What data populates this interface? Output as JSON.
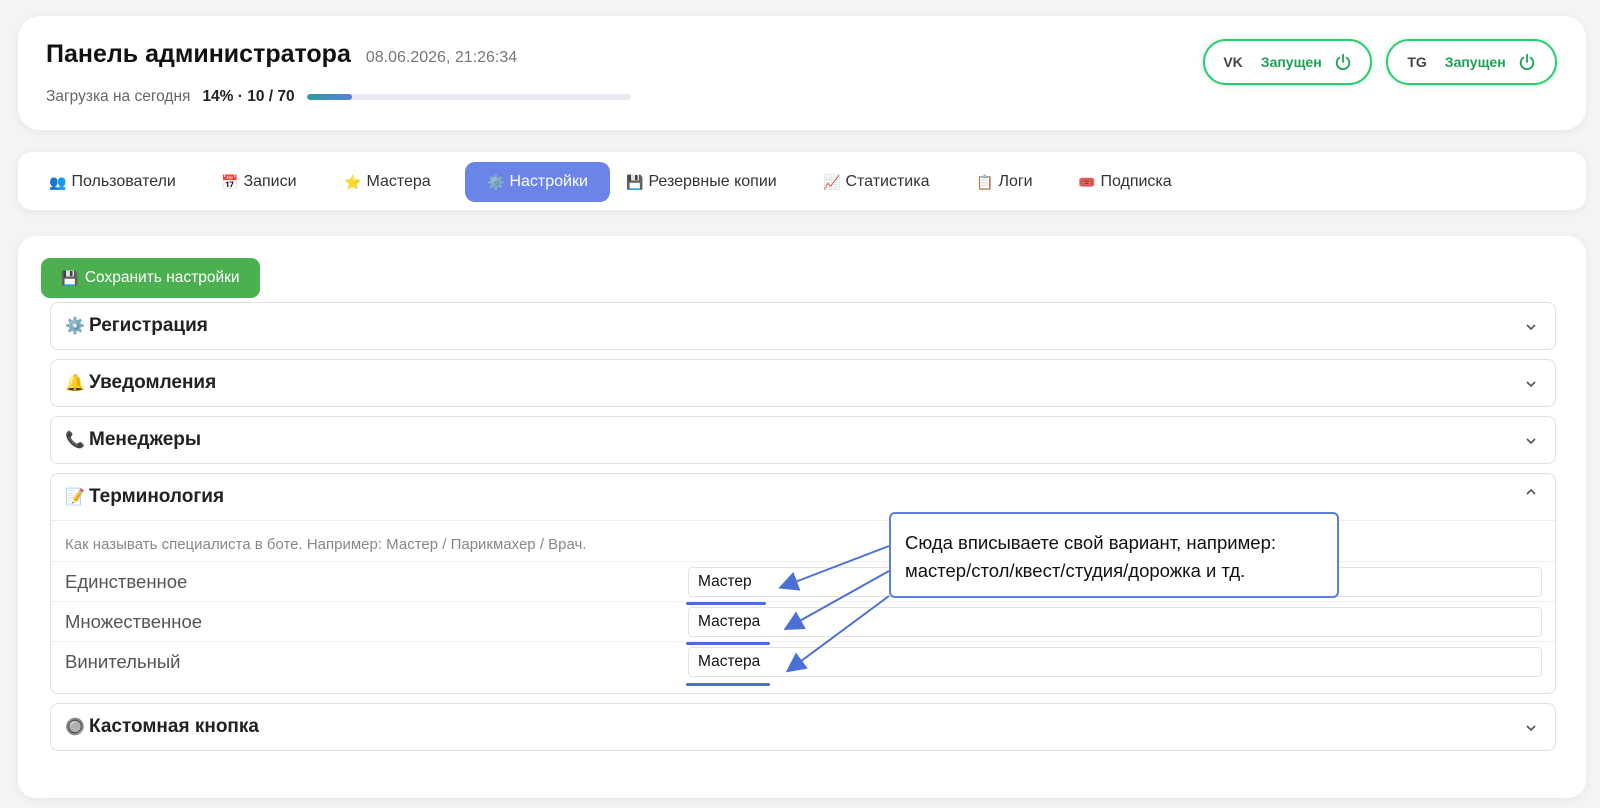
{
  "header": {
    "title": "Панель администратора",
    "datetime": "08.06.2026, 21:26:34",
    "load_label": "Загрузка на сегодня",
    "load_value": "14% · 10 / 70",
    "load_progress": 0.14
  },
  "status": [
    {
      "code": "VK",
      "state": "Запущен",
      "icon": "power-icon"
    },
    {
      "code": "TG",
      "state": "Запущен",
      "icon": "power-icon"
    }
  ],
  "colors": {
    "accent": "#6b84e8",
    "success": "#2ecc71",
    "save_button": "#4cb050",
    "callout_border": "#5b7fd8"
  },
  "tabs": [
    {
      "icon": "👥",
      "icon_name": "users-icon",
      "label": "Пользователи"
    },
    {
      "icon": "📅",
      "icon_name": "calendar-icon",
      "label": "Записи"
    },
    {
      "icon": "⭐",
      "icon_name": "star-icon",
      "label": "Мастера"
    },
    {
      "icon": "⚙️",
      "icon_name": "gear-icon",
      "label": "Настройки",
      "active": true
    },
    {
      "icon": "💾",
      "icon_name": "floppy-icon",
      "label": "Резервные копии"
    },
    {
      "icon": "📈",
      "icon_name": "chart-icon",
      "label": "Статистика"
    },
    {
      "icon": "📋",
      "icon_name": "clipboard-icon",
      "label": "Логи"
    },
    {
      "icon": "🎟️",
      "icon_name": "ticket-icon",
      "label": "Подписка"
    }
  ],
  "main": {
    "save_button": {
      "icon": "💾",
      "label": "Сохранить настройки"
    },
    "sections": [
      {
        "icon": "⚙️",
        "icon_name": "gear-icon",
        "title": "Регистрация",
        "expanded": false
      },
      {
        "icon": "🔔",
        "icon_name": "bell-icon",
        "title": "Уведомления",
        "expanded": false
      },
      {
        "icon": "📞",
        "icon_name": "phone-icon",
        "title": "Менеджеры",
        "expanded": false
      },
      {
        "icon": "📝",
        "icon_name": "memo-icon",
        "title": "Терминология",
        "expanded": true
      },
      {
        "icon": "🔘",
        "icon_name": "radio-button-icon",
        "title": "Кастомная кнопка",
        "expanded": false
      }
    ],
    "terminology": {
      "description": "Как называть специалиста в боте. Например: Мастер / Парикмахер / Врач.",
      "fields": [
        {
          "label": "Единственное",
          "value": "Мастер"
        },
        {
          "label": "Множественное",
          "value": "Мастера"
        },
        {
          "label": "Винительный",
          "value": "Мастера"
        }
      ]
    }
  },
  "callout": {
    "line1": "Сюда вписываете свой вариант, например:",
    "line2": "мастер/стол/квест/студия/дорожка и тд."
  }
}
